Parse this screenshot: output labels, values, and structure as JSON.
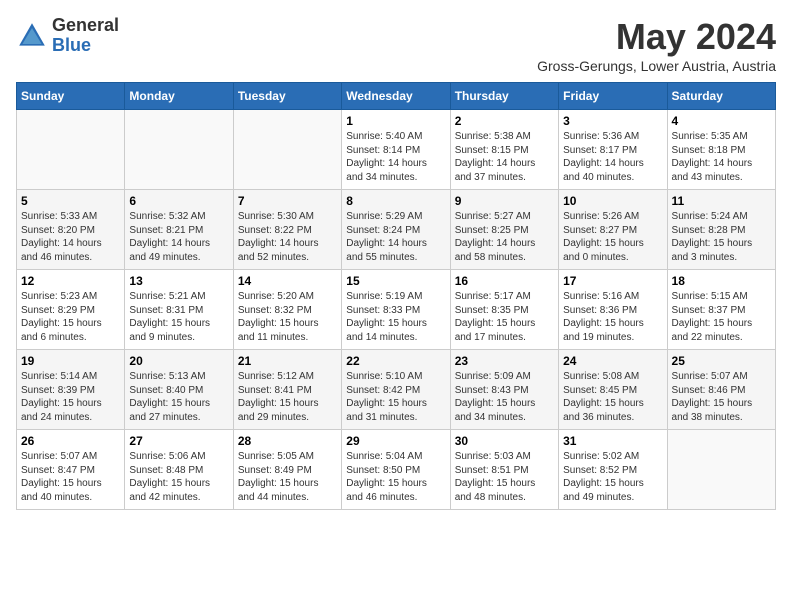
{
  "header": {
    "logo_general": "General",
    "logo_blue": "Blue",
    "month_title": "May 2024",
    "subtitle": "Gross-Gerungs, Lower Austria, Austria"
  },
  "days_of_week": [
    "Sunday",
    "Monday",
    "Tuesday",
    "Wednesday",
    "Thursday",
    "Friday",
    "Saturday"
  ],
  "weeks": [
    [
      {
        "day": "",
        "info": ""
      },
      {
        "day": "",
        "info": ""
      },
      {
        "day": "",
        "info": ""
      },
      {
        "day": "1",
        "info": "Sunrise: 5:40 AM\nSunset: 8:14 PM\nDaylight: 14 hours\nand 34 minutes."
      },
      {
        "day": "2",
        "info": "Sunrise: 5:38 AM\nSunset: 8:15 PM\nDaylight: 14 hours\nand 37 minutes."
      },
      {
        "day": "3",
        "info": "Sunrise: 5:36 AM\nSunset: 8:17 PM\nDaylight: 14 hours\nand 40 minutes."
      },
      {
        "day": "4",
        "info": "Sunrise: 5:35 AM\nSunset: 8:18 PM\nDaylight: 14 hours\nand 43 minutes."
      }
    ],
    [
      {
        "day": "5",
        "info": "Sunrise: 5:33 AM\nSunset: 8:20 PM\nDaylight: 14 hours\nand 46 minutes."
      },
      {
        "day": "6",
        "info": "Sunrise: 5:32 AM\nSunset: 8:21 PM\nDaylight: 14 hours\nand 49 minutes."
      },
      {
        "day": "7",
        "info": "Sunrise: 5:30 AM\nSunset: 8:22 PM\nDaylight: 14 hours\nand 52 minutes."
      },
      {
        "day": "8",
        "info": "Sunrise: 5:29 AM\nSunset: 8:24 PM\nDaylight: 14 hours\nand 55 minutes."
      },
      {
        "day": "9",
        "info": "Sunrise: 5:27 AM\nSunset: 8:25 PM\nDaylight: 14 hours\nand 58 minutes."
      },
      {
        "day": "10",
        "info": "Sunrise: 5:26 AM\nSunset: 8:27 PM\nDaylight: 15 hours\nand 0 minutes."
      },
      {
        "day": "11",
        "info": "Sunrise: 5:24 AM\nSunset: 8:28 PM\nDaylight: 15 hours\nand 3 minutes."
      }
    ],
    [
      {
        "day": "12",
        "info": "Sunrise: 5:23 AM\nSunset: 8:29 PM\nDaylight: 15 hours\nand 6 minutes."
      },
      {
        "day": "13",
        "info": "Sunrise: 5:21 AM\nSunset: 8:31 PM\nDaylight: 15 hours\nand 9 minutes."
      },
      {
        "day": "14",
        "info": "Sunrise: 5:20 AM\nSunset: 8:32 PM\nDaylight: 15 hours\nand 11 minutes."
      },
      {
        "day": "15",
        "info": "Sunrise: 5:19 AM\nSunset: 8:33 PM\nDaylight: 15 hours\nand 14 minutes."
      },
      {
        "day": "16",
        "info": "Sunrise: 5:17 AM\nSunset: 8:35 PM\nDaylight: 15 hours\nand 17 minutes."
      },
      {
        "day": "17",
        "info": "Sunrise: 5:16 AM\nSunset: 8:36 PM\nDaylight: 15 hours\nand 19 minutes."
      },
      {
        "day": "18",
        "info": "Sunrise: 5:15 AM\nSunset: 8:37 PM\nDaylight: 15 hours\nand 22 minutes."
      }
    ],
    [
      {
        "day": "19",
        "info": "Sunrise: 5:14 AM\nSunset: 8:39 PM\nDaylight: 15 hours\nand 24 minutes."
      },
      {
        "day": "20",
        "info": "Sunrise: 5:13 AM\nSunset: 8:40 PM\nDaylight: 15 hours\nand 27 minutes."
      },
      {
        "day": "21",
        "info": "Sunrise: 5:12 AM\nSunset: 8:41 PM\nDaylight: 15 hours\nand 29 minutes."
      },
      {
        "day": "22",
        "info": "Sunrise: 5:10 AM\nSunset: 8:42 PM\nDaylight: 15 hours\nand 31 minutes."
      },
      {
        "day": "23",
        "info": "Sunrise: 5:09 AM\nSunset: 8:43 PM\nDaylight: 15 hours\nand 34 minutes."
      },
      {
        "day": "24",
        "info": "Sunrise: 5:08 AM\nSunset: 8:45 PM\nDaylight: 15 hours\nand 36 minutes."
      },
      {
        "day": "25",
        "info": "Sunrise: 5:07 AM\nSunset: 8:46 PM\nDaylight: 15 hours\nand 38 minutes."
      }
    ],
    [
      {
        "day": "26",
        "info": "Sunrise: 5:07 AM\nSunset: 8:47 PM\nDaylight: 15 hours\nand 40 minutes."
      },
      {
        "day": "27",
        "info": "Sunrise: 5:06 AM\nSunset: 8:48 PM\nDaylight: 15 hours\nand 42 minutes."
      },
      {
        "day": "28",
        "info": "Sunrise: 5:05 AM\nSunset: 8:49 PM\nDaylight: 15 hours\nand 44 minutes."
      },
      {
        "day": "29",
        "info": "Sunrise: 5:04 AM\nSunset: 8:50 PM\nDaylight: 15 hours\nand 46 minutes."
      },
      {
        "day": "30",
        "info": "Sunrise: 5:03 AM\nSunset: 8:51 PM\nDaylight: 15 hours\nand 48 minutes."
      },
      {
        "day": "31",
        "info": "Sunrise: 5:02 AM\nSunset: 8:52 PM\nDaylight: 15 hours\nand 49 minutes."
      },
      {
        "day": "",
        "info": ""
      }
    ]
  ]
}
